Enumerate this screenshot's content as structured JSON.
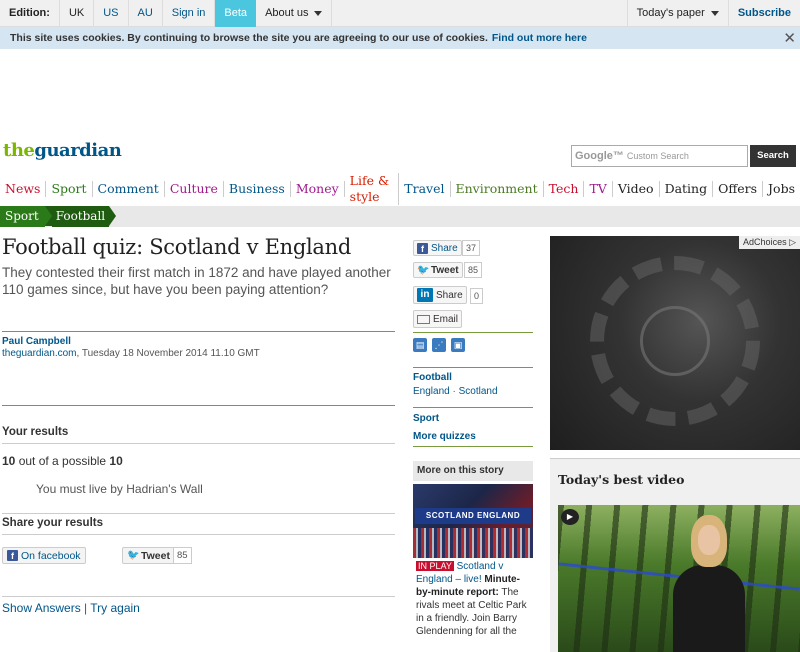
{
  "topbar": {
    "edition_label": "Edition:",
    "editions": [
      "UK",
      "US",
      "AU"
    ],
    "sign_in": "Sign in",
    "beta": "Beta",
    "about_us": "About us",
    "todays_paper": "Today's paper",
    "subscribe": "Subscribe"
  },
  "cookie": {
    "message": "This site uses cookies. By continuing to browse the site you are agreeing to our use of cookies.",
    "link": "Find out more here",
    "close": "✕"
  },
  "logo": {
    "part1": "the",
    "part2": "guardian"
  },
  "search": {
    "brand": "Google™",
    "placeholder": "Custom Search",
    "button": "Search"
  },
  "nav": {
    "items": [
      {
        "label": "News",
        "color": "#c8102e"
      },
      {
        "label": "Sport",
        "color": "#2b7a1a"
      },
      {
        "label": "Comment",
        "color": "#005689"
      },
      {
        "label": "Culture",
        "color": "#a1198c"
      },
      {
        "label": "Business",
        "color": "#005689"
      },
      {
        "label": "Money",
        "color": "#a1198c"
      },
      {
        "label": "Life & style",
        "color": "#d61d00"
      },
      {
        "label": "Travel",
        "color": "#005689"
      },
      {
        "label": "Environment",
        "color": "#4c7a24"
      },
      {
        "label": "Tech",
        "color": "#c8102e"
      },
      {
        "label": "TV",
        "color": "#a1198c"
      },
      {
        "label": "Video",
        "color": "#222222"
      },
      {
        "label": "Dating",
        "color": "#222222"
      },
      {
        "label": "Offers",
        "color": "#222222"
      },
      {
        "label": "Jobs",
        "color": "#222222"
      }
    ]
  },
  "breadcrumb": {
    "section": "Sport",
    "subsection": "Football"
  },
  "article": {
    "headline": "Football quiz: Scotland v England",
    "standfirst": "They contested their first match in 1872 and have played another 110 games since, but have you been paying attention?",
    "author": "Paul Campbell",
    "source": "theguardian.com",
    "date": ", Tuesday 18 November 2014 11.10 GMT"
  },
  "results": {
    "title": "Your results",
    "score": "10",
    "score_mid": " out of a possible ",
    "score_total": "10",
    "verdict": "You must live by Hadrian's Wall",
    "share_title": "Share your results",
    "facebook": "On facebook",
    "tweet": "Tweet",
    "tweet_count": "85",
    "show_answers": "Show Answers",
    "separator": " | ",
    "try_again": "Try again"
  },
  "social": {
    "fb_share": "Share",
    "fb_count": "37",
    "tweet": "Tweet",
    "tweet_count": "85",
    "li_share": "Share",
    "li_count": "0",
    "email": "Email"
  },
  "related": {
    "football": "Football",
    "england": "England",
    "dot": " · ",
    "scotland": "Scotland",
    "sport": "Sport",
    "more_quizzes": "More quizzes"
  },
  "more_story": {
    "title": "More on this story",
    "badge": "IN PLAY",
    "link": "Scotland v England – live!",
    "bold": "Minute-by-minute report:",
    "text": "The rivals meet at Celtic Park in a friendly. Join Barry Glendenning for all the",
    "image_banner": "SCOTLAND  ENGLAND"
  },
  "ad": {
    "adchoices": "AdChoices ▷"
  },
  "video": {
    "title": "Today's best video"
  }
}
